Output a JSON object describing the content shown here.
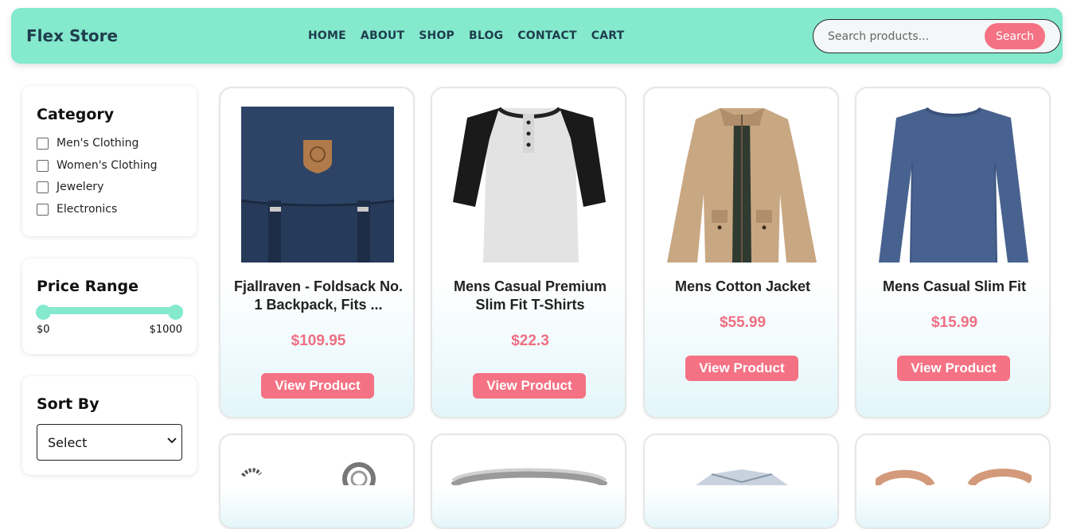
{
  "header": {
    "brand": "Flex Store",
    "nav": [
      "HOME",
      "ABOUT",
      "SHOP",
      "BLOG",
      "CONTACT",
      "CART"
    ],
    "search": {
      "placeholder": "Search products...",
      "button": "Search"
    },
    "colors": {
      "nav_bg": "#84e9cd",
      "accent": "#f47284"
    }
  },
  "sidebar": {
    "category": {
      "title": "Category",
      "options": [
        "Men's Clothing",
        "Women's Clothing",
        "Jewelery",
        "Electronics"
      ]
    },
    "price_range": {
      "title": "Price Range",
      "min_label": "$0",
      "max_label": "$1000",
      "min": 0,
      "max": 1000
    },
    "sort": {
      "title": "Sort By",
      "selected": "Select"
    }
  },
  "products": [
    {
      "title": "Fjallraven - Foldsack No. 1 Backpack, Fits ...",
      "price": "$109.95",
      "button": "View Product",
      "image": "navy-backpack-icon"
    },
    {
      "title": "Mens Casual Premium Slim Fit T-Shirts",
      "price": "$22.3",
      "button": "View Product",
      "image": "raglan-tshirt-icon"
    },
    {
      "title": "Mens Cotton Jacket",
      "price": "$55.99",
      "button": "View Product",
      "image": "khaki-jacket-icon"
    },
    {
      "title": "Mens Casual Slim Fit",
      "price": "$15.99",
      "button": "View Product",
      "image": "blue-longsleeve-icon"
    }
  ]
}
